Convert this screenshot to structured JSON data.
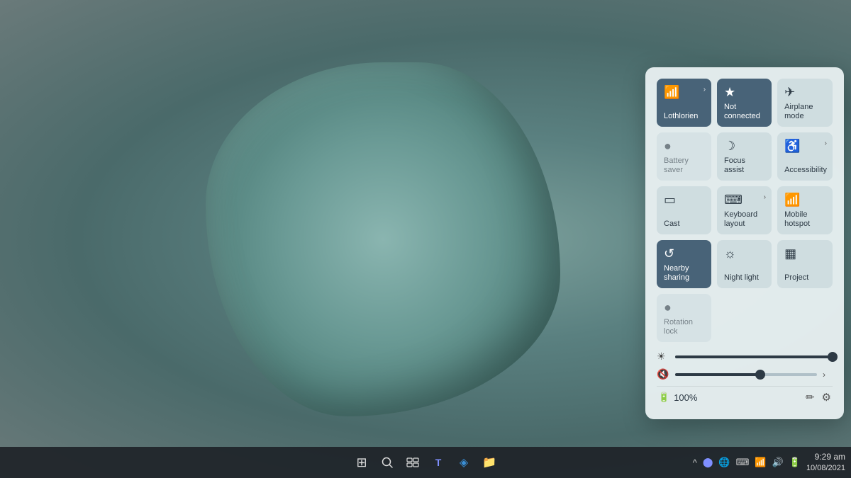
{
  "desktop": {
    "background": "green-flower-wallpaper"
  },
  "quick_settings": {
    "tiles": [
      {
        "id": "wifi",
        "label": "Lothlorien",
        "icon": "📶",
        "has_chevron": true,
        "active": true,
        "disabled": false
      },
      {
        "id": "bluetooth",
        "label": "Not connected",
        "icon": "🔵",
        "has_chevron": false,
        "active": true,
        "disabled": false
      },
      {
        "id": "airplane",
        "label": "Airplane mode",
        "icon": "✈",
        "has_chevron": false,
        "active": false,
        "disabled": false
      },
      {
        "id": "battery-saver",
        "label": "Battery saver",
        "icon": "🔋",
        "has_chevron": false,
        "active": false,
        "disabled": true
      },
      {
        "id": "focus-assist",
        "label": "Focus assist",
        "icon": "🌙",
        "has_chevron": false,
        "active": false,
        "disabled": false
      },
      {
        "id": "accessibility",
        "label": "Accessibility",
        "icon": "♿",
        "has_chevron": true,
        "active": false,
        "disabled": false
      },
      {
        "id": "cast",
        "label": "Cast",
        "icon": "📺",
        "has_chevron": false,
        "active": false,
        "disabled": false
      },
      {
        "id": "keyboard-layout",
        "label": "Keyboard layout",
        "icon": "⌨",
        "has_chevron": true,
        "active": false,
        "disabled": false
      },
      {
        "id": "mobile-hotspot",
        "label": "Mobile hotspot",
        "icon": "📡",
        "has_chevron": false,
        "active": false,
        "disabled": false
      },
      {
        "id": "nearby-sharing",
        "label": "Nearby sharing",
        "icon": "🔗",
        "has_chevron": false,
        "active": true,
        "disabled": false
      },
      {
        "id": "night-light",
        "label": "Night light",
        "icon": "💡",
        "has_chevron": false,
        "active": false,
        "disabled": false
      },
      {
        "id": "project",
        "label": "Project",
        "icon": "🖥",
        "has_chevron": false,
        "active": false,
        "disabled": false
      },
      {
        "id": "rotation-lock",
        "label": "Rotation lock",
        "icon": "🔄",
        "has_chevron": false,
        "active": false,
        "disabled": true
      }
    ],
    "brightness": {
      "icon": "☀",
      "value": 100,
      "percent": 100
    },
    "volume": {
      "icon": "🔇",
      "value": 60,
      "percent": 60,
      "has_chevron": true
    },
    "battery": {
      "icon": "🔋",
      "label": "100%",
      "edit_icon": "✏",
      "settings_icon": "⚙"
    }
  },
  "taskbar": {
    "left_icons": [],
    "center_icons": [
      {
        "id": "start",
        "icon": "⊞",
        "label": "Start"
      },
      {
        "id": "search",
        "icon": "🔍",
        "label": "Search"
      },
      {
        "id": "taskview",
        "icon": "⧉",
        "label": "Task View"
      },
      {
        "id": "teams",
        "icon": "T",
        "label": "Teams"
      },
      {
        "id": "edge",
        "icon": "◈",
        "label": "Microsoft Edge"
      },
      {
        "id": "explorer",
        "icon": "📁",
        "label": "File Explorer"
      }
    ],
    "sys_tray": {
      "time": "9:29 am",
      "date": "10/08/2021",
      "icons": [
        "^",
        "🌐",
        "🔊",
        "🔋",
        "⌨"
      ]
    }
  }
}
